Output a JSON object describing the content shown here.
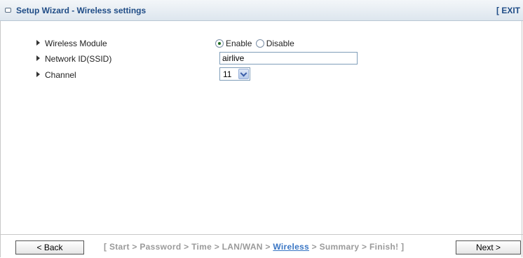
{
  "header": {
    "title": "Setup Wizard - Wireless settings",
    "exit_label": "[ EXIT"
  },
  "form": {
    "wireless_module": {
      "label": "Wireless Module",
      "options": [
        "Enable",
        "Disable"
      ],
      "selected": "Enable"
    },
    "ssid": {
      "label": "Network ID(SSID)",
      "value": "airlive"
    },
    "channel": {
      "label": "Channel",
      "value": "11"
    }
  },
  "footer": {
    "back_label": "< Back",
    "next_label": "Next >",
    "steps_open": "[",
    "steps_close": "]",
    "separator": ">",
    "steps": [
      "Start",
      "Password",
      "Time",
      "LAN/WAN",
      "Wireless",
      "Summary",
      "Finish!"
    ],
    "current_step": "Wireless"
  }
}
